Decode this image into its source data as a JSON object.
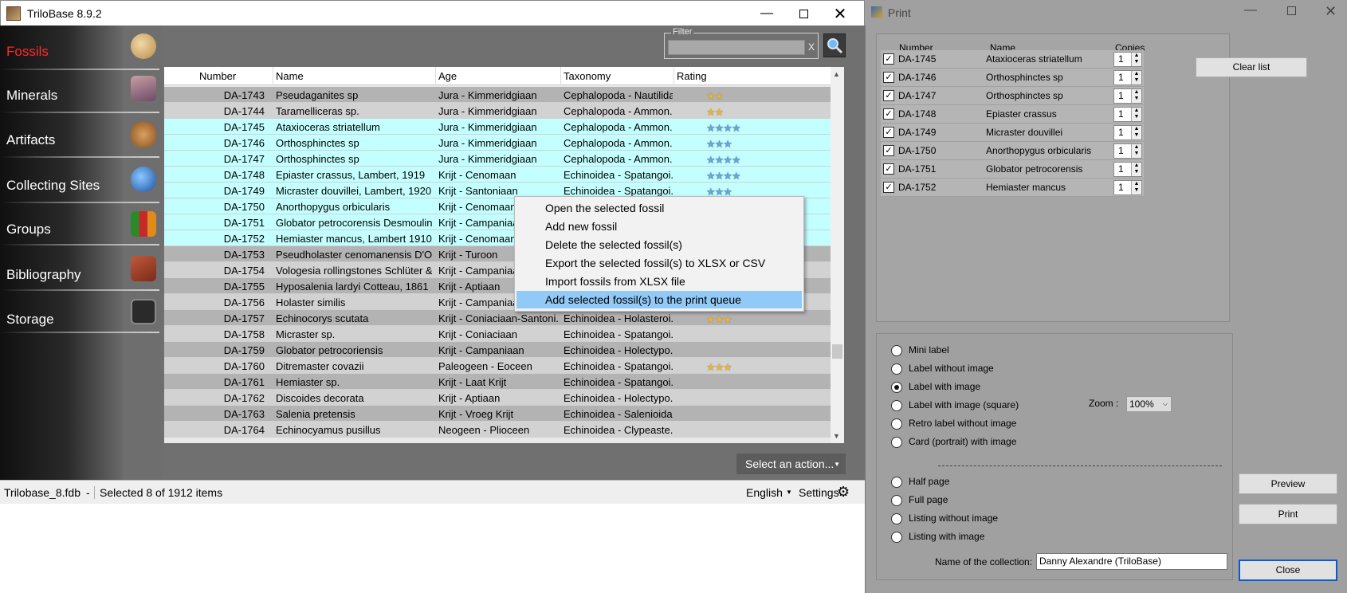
{
  "main": {
    "title": "TriloBase 8.9.2",
    "nav": [
      "Fossils",
      "Minerals",
      "Artifacts",
      "Collecting Sites",
      "Groups",
      "Bibliography",
      "Storage"
    ],
    "filter_label": "Filter",
    "filter_value": "",
    "filter_clear": "X",
    "columns": [
      "Number",
      "Name",
      "Age",
      "Taxonomy",
      "Rating"
    ],
    "rows": [
      {
        "num": "DA-1743",
        "name": "Pseudaganites sp",
        "age": "Jura - Kimmeridgiaan",
        "tax": "Cephalopoda - Nautilida",
        "rating": 2,
        "star": "gold",
        "sel": false
      },
      {
        "num": "DA-1744",
        "name": "Taramelliceras sp.",
        "age": "Jura - Kimmeridgiaan",
        "tax": "Cephalopoda - Ammon...",
        "rating": 2,
        "star": "gold",
        "sel": false
      },
      {
        "num": "DA-1745",
        "name": "Ataxioceras striatellum",
        "age": "Jura - Kimmeridgiaan",
        "tax": "Cephalopoda - Ammon...",
        "rating": 4,
        "star": "blue",
        "sel": true
      },
      {
        "num": "DA-1746",
        "name": "Orthosphinctes sp",
        "age": "Jura - Kimmeridgiaan",
        "tax": "Cephalopoda - Ammon...",
        "rating": 3,
        "star": "blue",
        "sel": true
      },
      {
        "num": "DA-1747",
        "name": "Orthosphinctes sp",
        "age": "Jura - Kimmeridgiaan",
        "tax": "Cephalopoda - Ammon...",
        "rating": 4,
        "star": "blue",
        "sel": true
      },
      {
        "num": "DA-1748",
        "name": "Epiaster crassus, Lambert, 1919",
        "age": "Krijt - Cenomaan",
        "tax": "Echinoidea - Spatangoi...",
        "rating": 4,
        "star": "blue",
        "sel": true
      },
      {
        "num": "DA-1749",
        "name": "Micraster douvillei, Lambert, 1920.",
        "age": "Krijt - Santoniaan",
        "tax": "Echinoidea - Spatangoi...",
        "rating": 3,
        "star": "blue",
        "sel": true
      },
      {
        "num": "DA-1750",
        "name": "Anorthopygus orbicularis",
        "age": "Krijt - Cenomaan",
        "tax": "",
        "rating": 0,
        "star": "blue",
        "sel": true
      },
      {
        "num": "DA-1751",
        "name": "Globator petrocorensis Desmoulin...",
        "age": "Krijt - Campaniaan",
        "tax": "",
        "rating": 0,
        "star": "blue",
        "sel": true
      },
      {
        "num": "DA-1752",
        "name": "Hemiaster mancus, Lambert 1910.",
        "age": "Krijt - Cenomaan",
        "tax": "",
        "rating": 0,
        "star": "blue",
        "sel": true
      },
      {
        "num": "DA-1753",
        "name": "Pseudholaster cenomanensis D'O...",
        "age": "Krijt - Turoon",
        "tax": "",
        "rating": 0,
        "star": "gold",
        "sel": false
      },
      {
        "num": "DA-1754",
        "name": "Vologesia rollingstones Schlüter & ...",
        "age": "Krijt - Campaniaan",
        "tax": "",
        "rating": 0,
        "star": "gold",
        "sel": false
      },
      {
        "num": "DA-1755",
        "name": "Hyposalenia lardyi Cotteau, 1861",
        "age": "Krijt - Aptiaan",
        "tax": "",
        "rating": 0,
        "star": "gold",
        "sel": false
      },
      {
        "num": "DA-1756",
        "name": "Holaster similis",
        "age": "Krijt - Campaniaan",
        "tax": "",
        "rating": 0,
        "star": "gold",
        "sel": false
      },
      {
        "num": "DA-1757",
        "name": "Echinocorys scutata",
        "age": "Krijt - Coniaciaan-Santoni...",
        "tax": "Echinoidea - Holasteroi...",
        "rating": 3,
        "star": "gold",
        "sel": false
      },
      {
        "num": "DA-1758",
        "name": "Micraster sp.",
        "age": "Krijt - Coniaciaan",
        "tax": "Echinoidea - Spatangoi...",
        "rating": 0,
        "star": "gold",
        "sel": false
      },
      {
        "num": "DA-1759",
        "name": "Globator petrocoriensis",
        "age": "Krijt - Campaniaan",
        "tax": "Echinoidea - Holectypo...",
        "rating": 0,
        "star": "gold",
        "sel": false
      },
      {
        "num": "DA-1760",
        "name": "Ditremaster covazii",
        "age": "Paleogeen - Eoceen",
        "tax": "Echinoidea - Spatangoi...",
        "rating": 3,
        "star": "gold",
        "sel": false
      },
      {
        "num": "DA-1761",
        "name": "Hemiaster sp.",
        "age": "Krijt - Laat Krijt",
        "tax": "Echinoidea - Spatangoi...",
        "rating": 0,
        "star": "gold",
        "sel": false
      },
      {
        "num": "DA-1762",
        "name": "Discoides decorata",
        "age": "Krijt - Aptiaan",
        "tax": "Echinoidea - Holectypo...",
        "rating": 0,
        "star": "gold",
        "sel": false
      },
      {
        "num": "DA-1763",
        "name": "Salenia pretensis",
        "age": "Krijt - Vroeg Krijt",
        "tax": "Echinoidea - Salenioida",
        "rating": 0,
        "star": "gold",
        "sel": false
      },
      {
        "num": "DA-1764",
        "name": "Echinocyamus pusillus",
        "age": "Neogeen - Plioceen",
        "tax": "Echinoidea - Clypeaste...",
        "rating": 0,
        "star": "gold",
        "sel": false
      }
    ],
    "context_menu": [
      "Open the selected fossil",
      "Add new fossil",
      "Delete the selected fossil(s)",
      "Export the selected fossil(s) to XLSX or CSV",
      "Import fossils from XLSX file",
      "Add selected fossil(s) to the print queue"
    ],
    "action_button": "Select an action...",
    "status_db": "Trilobase_8.fdb",
    "status_sep": "-",
    "status_sel": "Selected 8 of 1912 items",
    "language": "English",
    "settings": "Settings"
  },
  "print": {
    "title": "Print",
    "columns": [
      "Number",
      "Name",
      "Copies"
    ],
    "items": [
      {
        "num": "DA-1745",
        "name": "Ataxioceras striatellum",
        "copies": "1"
      },
      {
        "num": "DA-1746",
        "name": "Orthosphinctes sp",
        "copies": "1"
      },
      {
        "num": "DA-1747",
        "name": "Orthosphinctes sp",
        "copies": "1"
      },
      {
        "num": "DA-1748",
        "name": "Epiaster crassus",
        "copies": "1"
      },
      {
        "num": "DA-1749",
        "name": "Micraster douvillei",
        "copies": "1"
      },
      {
        "num": "DA-1750",
        "name": "Anorthopygus orbicularis",
        "copies": "1"
      },
      {
        "num": "DA-1751",
        "name": "Globator petrocorensis",
        "copies": "1"
      },
      {
        "num": "DA-1752",
        "name": "Hemiaster mancus",
        "copies": "1"
      }
    ],
    "clear_list": "Clear list",
    "options_a": [
      "Mini label",
      "Label without image",
      "Label with image",
      "Label with image (square)",
      "Retro label without image",
      "Card (portrait) with image"
    ],
    "options_b": [
      "Half page",
      "Full page",
      "Listing without image",
      "Listing with image"
    ],
    "selected_option": "Label with image",
    "zoom_label": "Zoom :",
    "zoom_value": "100%",
    "collection_label": "Name of the collection:",
    "collection_value": "Danny Alexandre (TriloBase)",
    "preview": "Preview",
    "print_btn": "Print",
    "close": "Close"
  }
}
